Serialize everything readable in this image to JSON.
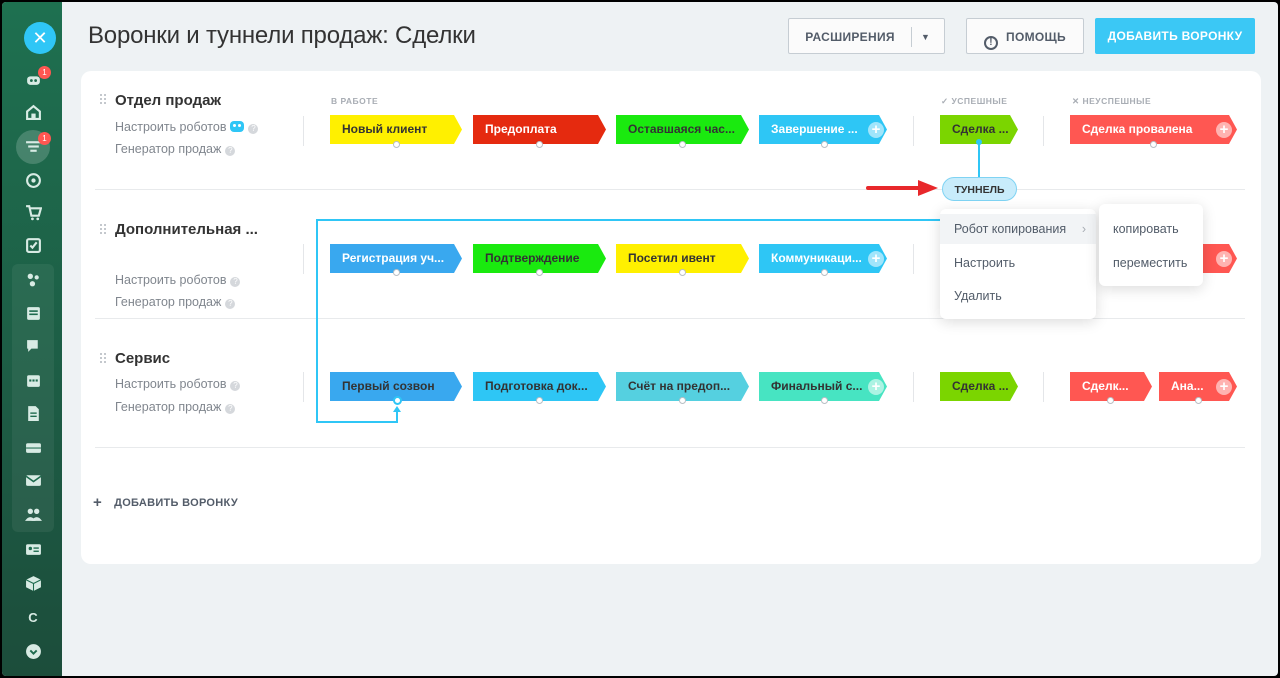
{
  "header": {
    "title": "Воронки и туннели продаж: Сделки",
    "extensions_label": "РАСШИРЕНИЯ",
    "help_label": "ПОМОЩЬ",
    "add_funnel_label": "ДОБАВИТЬ ВОРОНКУ"
  },
  "sidebar": {
    "badges": [
      "1",
      "1"
    ],
    "letter": "C"
  },
  "sections": {
    "in_work": "В РАБОТЕ",
    "success": "✓ УСПЕШНЫЕ",
    "fail": "✕ НЕУСПЕШНЫЕ"
  },
  "funnels": [
    {
      "name": "Отдел продаж",
      "robots_link": "Настроить роботов",
      "generator_link": "Генератор продаж",
      "stages": [
        "Новый клиент",
        "Предоплата",
        "Оставшаяся час...",
        "Завершение ..."
      ],
      "success": [
        "Сделка ..."
      ],
      "fail": [
        "Сделка провалена"
      ]
    },
    {
      "name": "Дополнительная ...",
      "robots_link": "Настроить роботов",
      "generator_link": "Генератор продаж",
      "stages": [
        "Регистрация уч...",
        "Подтверждение",
        "Посетил ивент",
        "Коммуникаци..."
      ],
      "success": [
        ""
      ],
      "fail": [
        ""
      ]
    },
    {
      "name": "Сервис",
      "robots_link": "Настроить роботов",
      "generator_link": "Генератор продаж",
      "stages": [
        "Первый созвон",
        "Подготовка док...",
        "Счёт на предоп...",
        "Финальный с..."
      ],
      "success": [
        "Сделка ..."
      ],
      "fail": [
        "Сделк...",
        "Ана..."
      ]
    }
  ],
  "tunnel": {
    "label": "ТУННЕЛЬ"
  },
  "context_menu": {
    "items": [
      "Робот копирования",
      "Настроить",
      "Удалить"
    ]
  },
  "submenu": {
    "items": [
      "копировать",
      "переместить"
    ]
  },
  "footer": {
    "add_funnel_label": "ДОБАВИТЬ ВОРОНКУ"
  },
  "colors": {
    "accent": "#2fc6f6",
    "sidebar": "#1e6b4e",
    "arrow": "#e8282b"
  }
}
